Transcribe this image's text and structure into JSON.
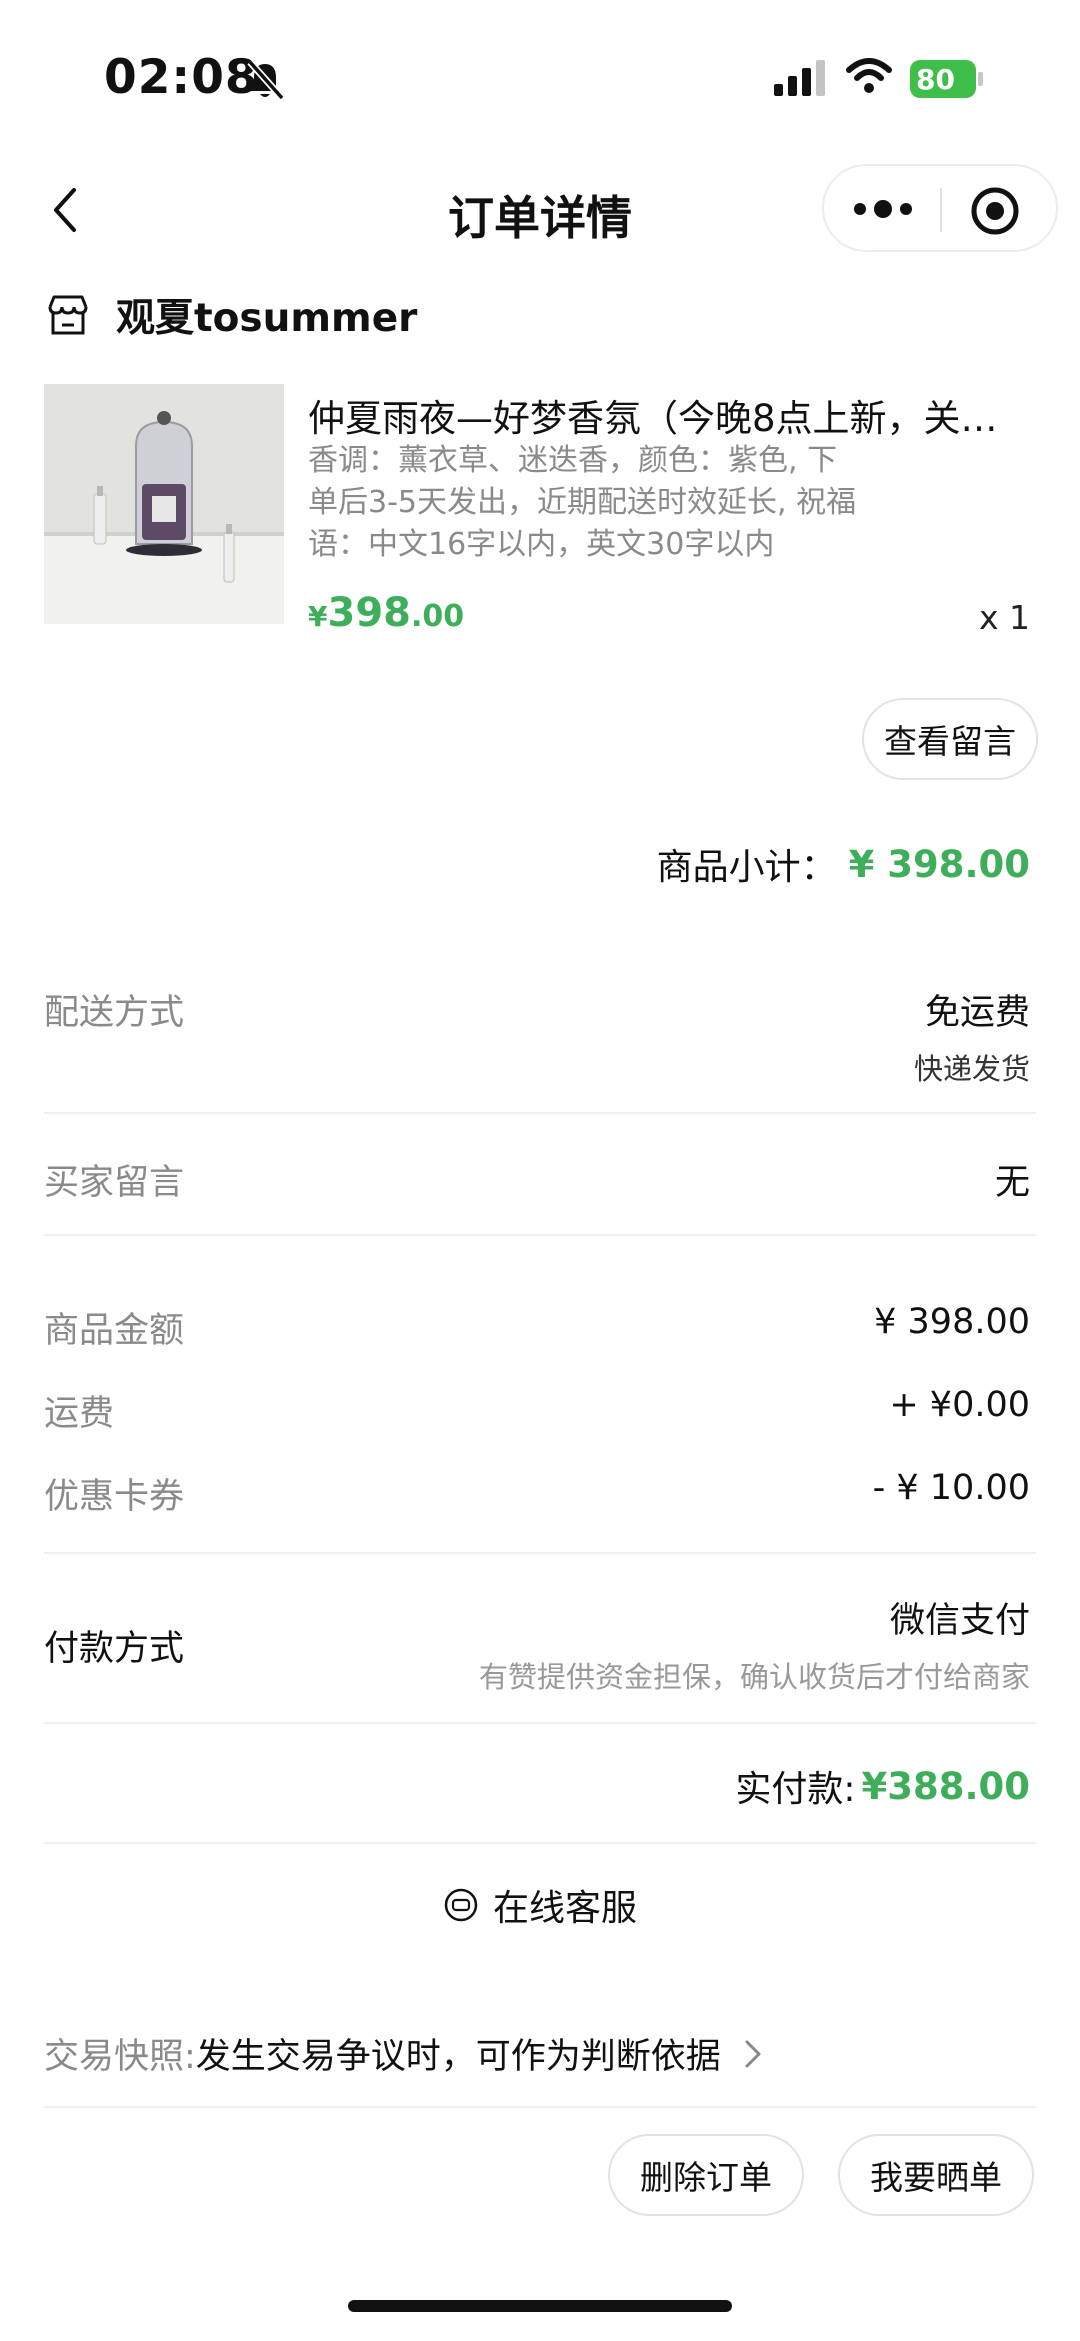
{
  "status_bar": {
    "time": "02:08",
    "battery": "80"
  },
  "header": {
    "title": "订单详情"
  },
  "shop": {
    "name": "观夏tosummer"
  },
  "product": {
    "title": "仲夏雨夜—好梦香氛（今晚8点上新，关…",
    "spec_lines": [
      "香调：薰衣草、迷迭香，颜色：紫色, 下",
      "单后3-5天发出，近期配送时效延长, 祝福",
      "语：中文16字以内，英文30字以内"
    ],
    "price_symbol": "¥",
    "price_integer": "398",
    "price_decimal": ".00",
    "quantity": "x 1"
  },
  "buttons": {
    "view_message": "查看留言",
    "delete_order": "删除订单",
    "share_order": "我要晒单"
  },
  "subtotal": {
    "label": "商品小计：",
    "value": "¥ 398.00"
  },
  "delivery": {
    "label": "配送方式",
    "value": "免运费",
    "sub": "快递发货"
  },
  "buyer_message": {
    "label": "买家留言",
    "value": "无"
  },
  "amounts": {
    "goods_label": "商品金额",
    "goods_value": "¥ 398.00",
    "shipping_label": "运费",
    "shipping_value": "+ ¥0.00",
    "coupon_label": "优惠卡券",
    "coupon_value": "- ¥ 10.00"
  },
  "payment": {
    "label": "付款方式",
    "value": "微信支付",
    "note": "有赞提供资金担保，确认收货后才付给商家"
  },
  "paid": {
    "label": "实付款:",
    "value": "¥388.00"
  },
  "service": {
    "label": "在线客服"
  },
  "snapshot": {
    "label": "交易快照:",
    "text": "发生交易争议时，可作为判断依据"
  },
  "colors": {
    "accent_green": "#3fae5b",
    "battery_green": "#3fbf4a"
  }
}
